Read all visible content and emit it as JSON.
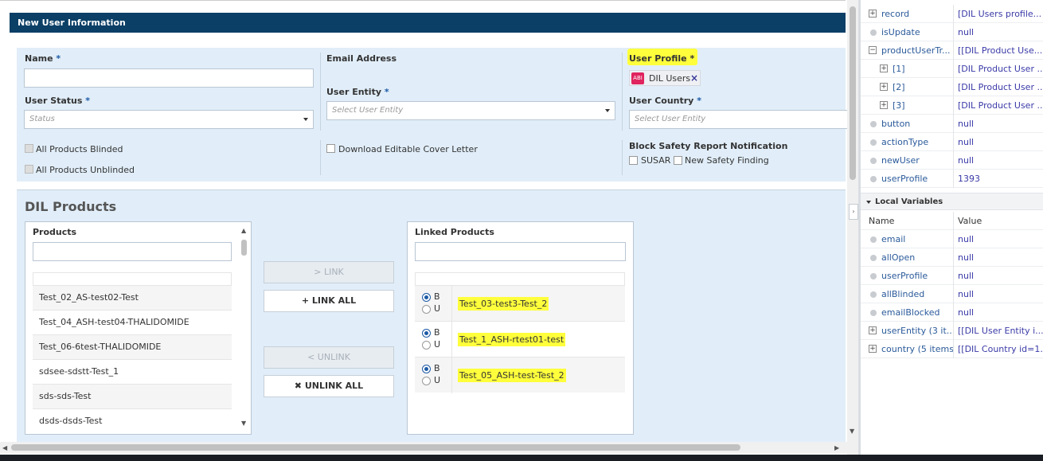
{
  "form": {
    "title": "New User Information",
    "name_label": "Name",
    "required_mark": "*",
    "email_label": "Email Address",
    "user_profile_label": "User Profile",
    "user_profile_chip": "DIL Users",
    "user_status_label": "User Status",
    "user_status_placeholder": "Status",
    "user_entity_label": "User Entity",
    "user_entity_placeholder": "Select User Entity",
    "user_country_label": "User Country",
    "user_country_placeholder": "Select User Entity",
    "all_products_blinded": "All Products Blinded",
    "all_products_unblinded": "All Products Unblinded",
    "download_cover_letter": "Download Editable Cover Letter",
    "block_safety_label": "Block Safety Report Notification",
    "susar": "SUSAR",
    "new_safety_finding": "New Safety Finding",
    "chip_icon_text": "ABI"
  },
  "products": {
    "section_title": "DIL Products",
    "products_header": "Products",
    "linked_header": "Linked Products",
    "items": [
      "Test_02_AS-test02-Test",
      "Test_04_ASH-test04-THALIDOMIDE",
      "Test_06-6test-THALIDOMIDE",
      "sdsee-sdstt-Test_1",
      "sds-sds-Test",
      "dsds-dsds-Test"
    ],
    "link": "> LINK",
    "link_all": "+ LINK ALL",
    "unlink": "< UNLINK",
    "unlink_all": "✖ UNLINK ALL",
    "linked": [
      {
        "name": "Test_03-test3-Test_2",
        "b": "B",
        "u": "U",
        "selected": "B"
      },
      {
        "name": "Test_1_ASH-rtest01-test",
        "b": "B",
        "u": "U",
        "selected": "B"
      },
      {
        "name": "Test_05_ASH-test-Test_2",
        "b": "B",
        "u": "U",
        "selected": "B"
      }
    ]
  },
  "debugger": {
    "rows": [
      {
        "name": "record",
        "value": "[DIL Users profile...",
        "kind": "plus"
      },
      {
        "name": "isUpdate",
        "value": "null",
        "kind": "dot"
      },
      {
        "name": "productUserTr...",
        "value": "[[DIL Product Use...",
        "kind": "minus"
      },
      {
        "name": "[1]",
        "value": "[DIL Product User ...",
        "kind": "plus-indent"
      },
      {
        "name": "[2]",
        "value": "[DIL Product User ...",
        "kind": "plus-indent"
      },
      {
        "name": "[3]",
        "value": "[DIL Product User ...",
        "kind": "plus-indent"
      },
      {
        "name": "button",
        "value": "null",
        "kind": "dot"
      },
      {
        "name": "actionType",
        "value": "null",
        "kind": "dot"
      },
      {
        "name": "newUser",
        "value": "null",
        "kind": "dot"
      },
      {
        "name": "userProfile",
        "value": "1393",
        "kind": "dot"
      }
    ],
    "local_section": "Local Variables",
    "col_name": "Name",
    "col_value": "Value",
    "locals": [
      {
        "name": "email",
        "value": "null",
        "kind": "dot"
      },
      {
        "name": "allOpen",
        "value": "null",
        "kind": "dot"
      },
      {
        "name": "userProfile",
        "value": "null",
        "kind": "dot"
      },
      {
        "name": "allBlinded",
        "value": "null",
        "kind": "dot"
      },
      {
        "name": "emailBlocked",
        "value": "null",
        "kind": "dot"
      },
      {
        "name": "userEntity (3 it...",
        "value": "[[DIL User Entity i...",
        "kind": "plus"
      },
      {
        "name": "country (5 items)",
        "value": "[[DIL Country id=1...",
        "kind": "plus"
      }
    ]
  },
  "colors": {
    "title_bar": "#0b3f66",
    "panel_bg": "#e1eef9",
    "highlight": "#ffff3c",
    "accent": "#1c5aa6"
  }
}
